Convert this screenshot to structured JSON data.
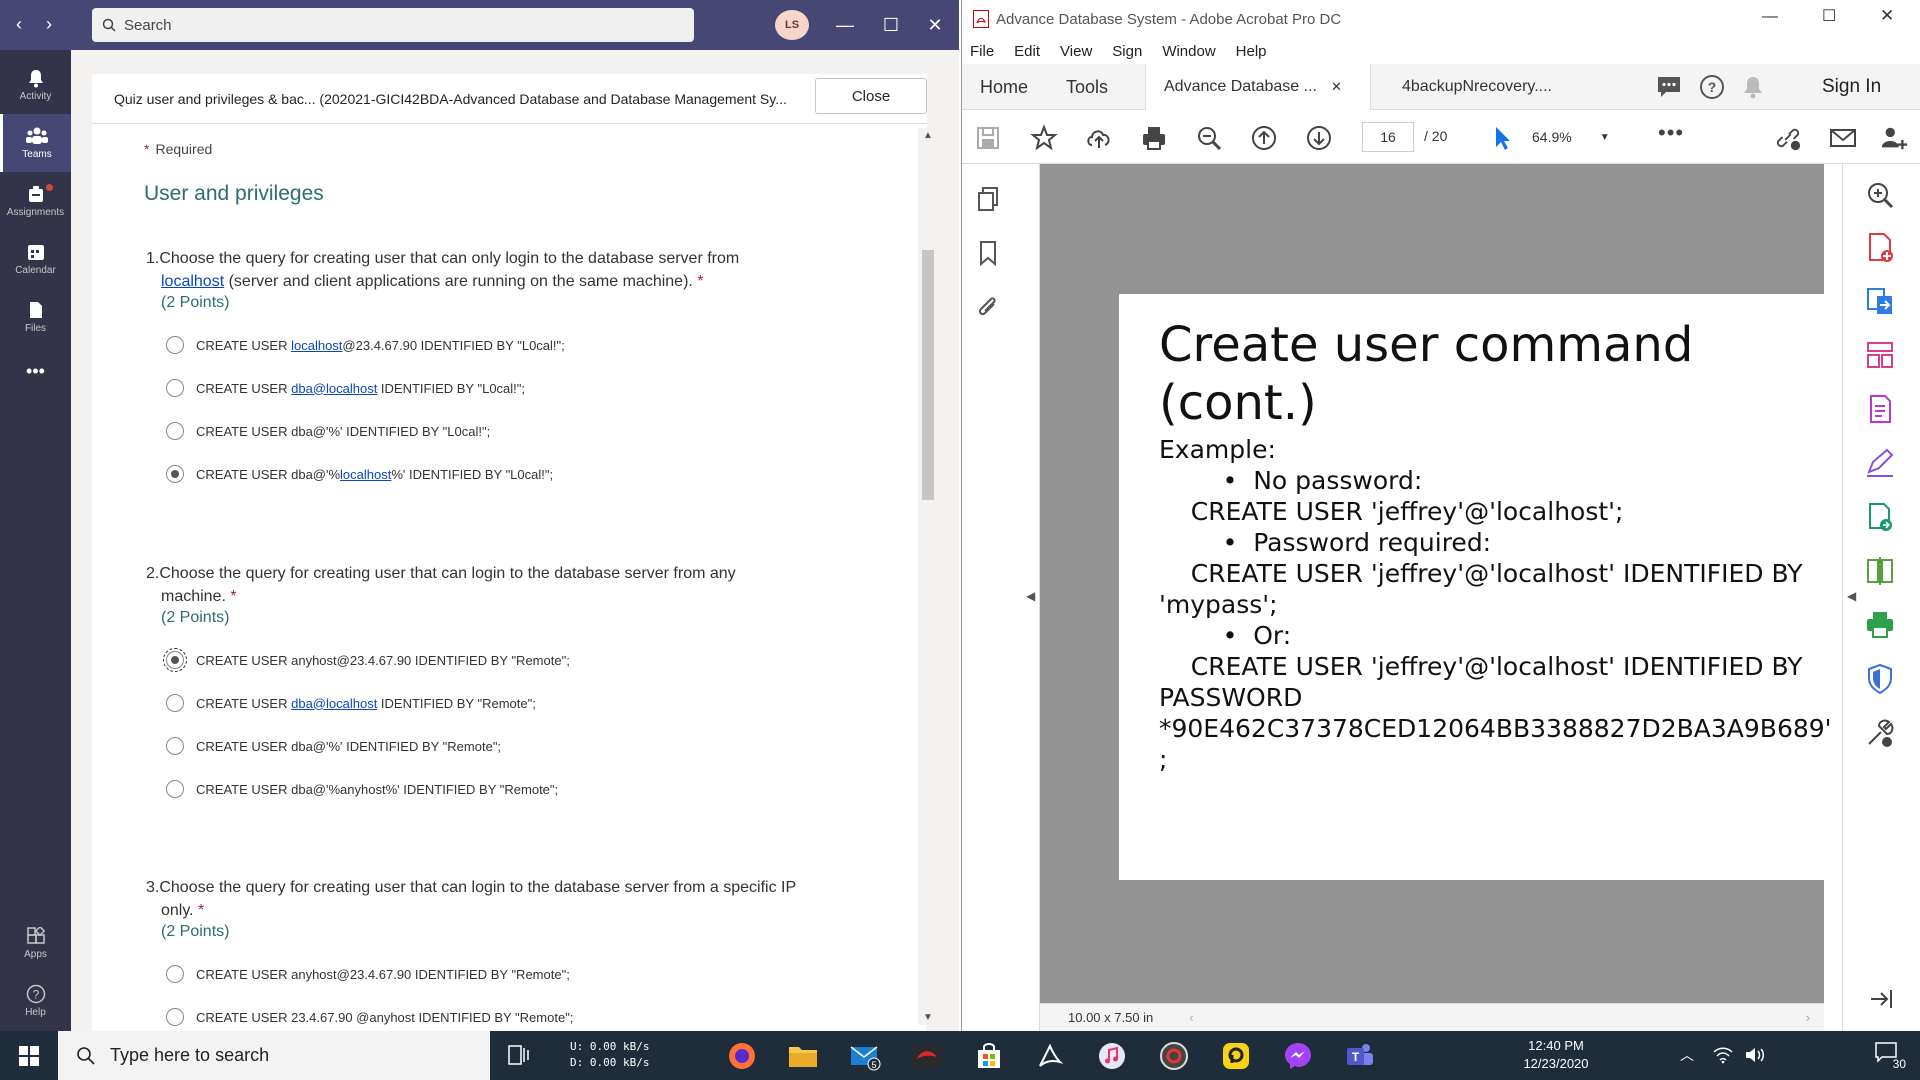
{
  "teams": {
    "search_placeholder": "Search",
    "avatar_initials": "LS",
    "rail": [
      {
        "label": "Activity"
      },
      {
        "label": "Teams"
      },
      {
        "label": "Assignments"
      },
      {
        "label": "Calendar"
      },
      {
        "label": "Files"
      },
      {
        "label": "Apps"
      },
      {
        "label": "Help"
      }
    ],
    "quiz_title": "Quiz user and privileges & bac... (202021-GICI42BDA-Advanced Database and Database Management Sy...",
    "close_label": "Close",
    "required_label": "Required",
    "required_star": "*",
    "section_title": "User and privileges",
    "questions": [
      {
        "number": "1.",
        "text": "Choose the query for creating user that can only login to the database server from",
        "link": "localhost",
        "text2": " (server and client applications are running on the same machine).",
        "star": " *",
        "points": "(2 Points)",
        "options": [
          {
            "pre": "CREATE USER ",
            "link": "localhost",
            "post": "@23.4.67.90 IDENTIFIED BY \"L0cal!\";",
            "selected": false
          },
          {
            "pre": "CREATE USER ",
            "link": "dba@localhost",
            "post": " IDENTIFIED BY \"L0cal!\";",
            "selected": false
          },
          {
            "pre": "CREATE USER dba@'%' IDENTIFIED BY \"L0cal!\";",
            "link": "",
            "post": "",
            "selected": false
          },
          {
            "pre": "CREATE USER dba@'%",
            "link": "localhost",
            "post": "%' IDENTIFIED BY \"L0cal!\";",
            "selected": true
          }
        ]
      },
      {
        "number": "2.",
        "text": "Choose the query for creating user that can login to the database server from any",
        "text2": "machine.",
        "star": " *",
        "points": "(2 Points)",
        "options": [
          {
            "pre": "CREATE USER anyhost@23.4.67.90 IDENTIFIED BY \"Remote\";",
            "link": "",
            "post": "",
            "selected": true
          },
          {
            "pre": "CREATE USER ",
            "link": "dba@localhost",
            "post": " IDENTIFIED BY \"Remote\";",
            "selected": false
          },
          {
            "pre": "CREATE USER dba@'%' IDENTIFIED BY \"Remote\";",
            "link": "",
            "post": "",
            "selected": false
          },
          {
            "pre": "CREATE USER dba@'%anyhost%' IDENTIFIED BY \"Remote\";",
            "link": "",
            "post": "",
            "selected": false
          }
        ]
      },
      {
        "number": "3.",
        "text": "Choose the query for creating user that can login to the database server from a specific IP",
        "text2": "only.",
        "star": " *",
        "points": "(2 Points)",
        "options": [
          {
            "pre": "CREATE USER anyhost@23.4.67.90 IDENTIFIED BY \"Remote\";",
            "link": "",
            "post": "",
            "selected": false
          },
          {
            "pre": "CREATE USER 23.4.67.90 @anyhost IDENTIFIED BY \"Remote\";",
            "link": "",
            "post": "",
            "selected": false
          }
        ]
      }
    ]
  },
  "acrobat": {
    "window_title": "Advance Database System - Adobe Acrobat Pro DC",
    "menu": [
      "File",
      "Edit",
      "View",
      "Sign",
      "Window",
      "Help"
    ],
    "tabs": {
      "home": "Home",
      "tools": "Tools",
      "doc1": "Advance Database ...",
      "doc2": "4backupNrecovery....",
      "signin": "Sign In"
    },
    "page_current": "16",
    "page_total": "/  20",
    "zoom": "64.9%",
    "page_size": "10.00 x 7.50 in",
    "slide": {
      "title": "Create user command (cont.)",
      "body": "Example:\n        •  No password:\n    CREATE USER 'jeffrey'@'localhost';\n        •  Password required:\n    CREATE USER 'jeffrey'@'localhost' IDENTIFIED BY\n'mypass';\n        •  Or:\n    CREATE USER 'jeffrey'@'localhost' IDENTIFIED BY\nPASSWORD\n*90E462C37378CED12064BB3388827D2BA3A9B689'\n;"
    }
  },
  "taskbar": {
    "search_placeholder": "Type here to search",
    "net_up": "U:     0.00 kB/s",
    "net_down": "D:     0.00 kB/s",
    "mail_badge": "5",
    "time": "12:40 PM",
    "date": "12/23/2020",
    "notif_count": "30"
  },
  "colors": {
    "teams_header": "#464775",
    "teams_rail": "#33344a",
    "link": "#0b46c2",
    "required": "#a4262c",
    "accent_teal": "#2c6d6f",
    "taskbar": "#1f2d3a"
  }
}
